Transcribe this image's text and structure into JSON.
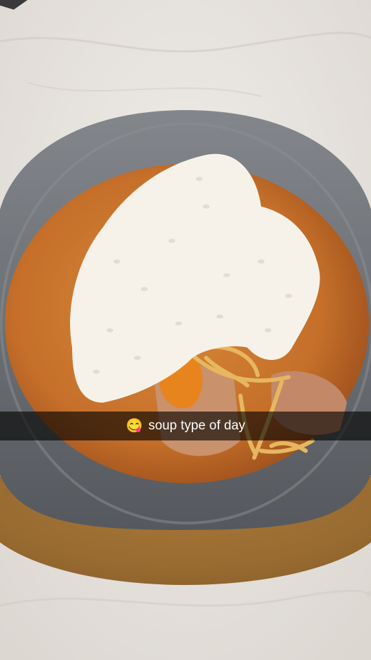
{
  "photo": {
    "subject": "bowl-of-soup",
    "colors": {
      "counter": "#e7e3de",
      "plate": "#a8773b",
      "bowl": "#6c7177",
      "broth": "#c56f2a",
      "rice": "#f6f2ea",
      "noodles": "#e6b75f",
      "pumpkin": "#e8841d",
      "meat": "#c9916c"
    }
  },
  "caption": {
    "emoji": "😋",
    "text": "soup type of day"
  }
}
